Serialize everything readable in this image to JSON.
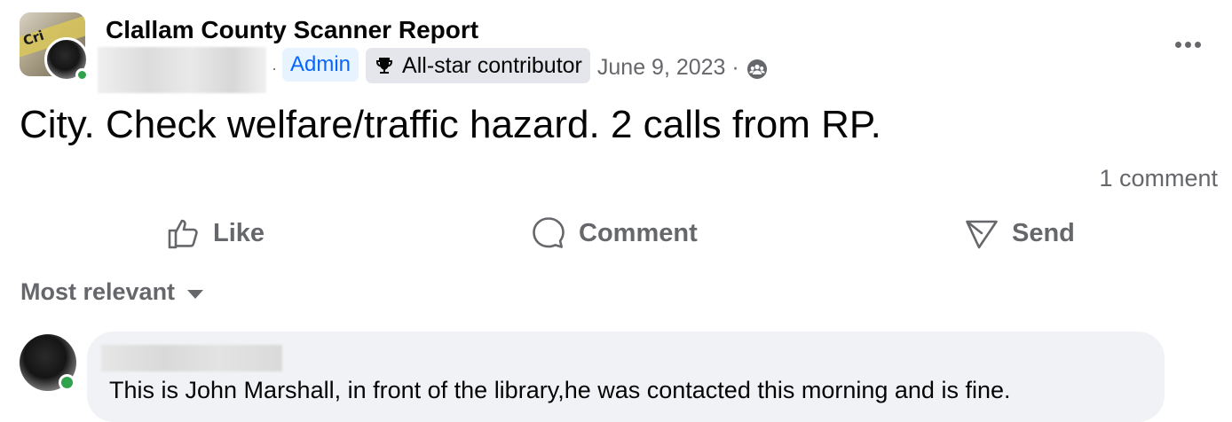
{
  "post": {
    "group_name": "Clallam County Scanner Report",
    "group_avatar_text": "Cri",
    "separator": "·",
    "admin_badge": "Admin",
    "allstar_badge": "All-star contributor",
    "date": "June 9, 2023 ·",
    "audience_icon": "group-audience-icon",
    "body_text": "City. Check welfare/traffic hazard. 2 calls from RP.",
    "comment_count": "1 comment"
  },
  "actions": {
    "like": "Like",
    "comment": "Comment",
    "send": "Send"
  },
  "comments_section": {
    "sort_label": "Most relevant",
    "comments": [
      {
        "text": "This is John Marshall, in front of the library,he was contacted this morning and is fine."
      }
    ]
  },
  "colors": {
    "online": "#31a24c",
    "admin_badge_bg": "#e7f3ff",
    "admin_badge_text": "#0866ff",
    "secondary_text": "#65676b",
    "comment_bubble": "#f0f2f5"
  }
}
